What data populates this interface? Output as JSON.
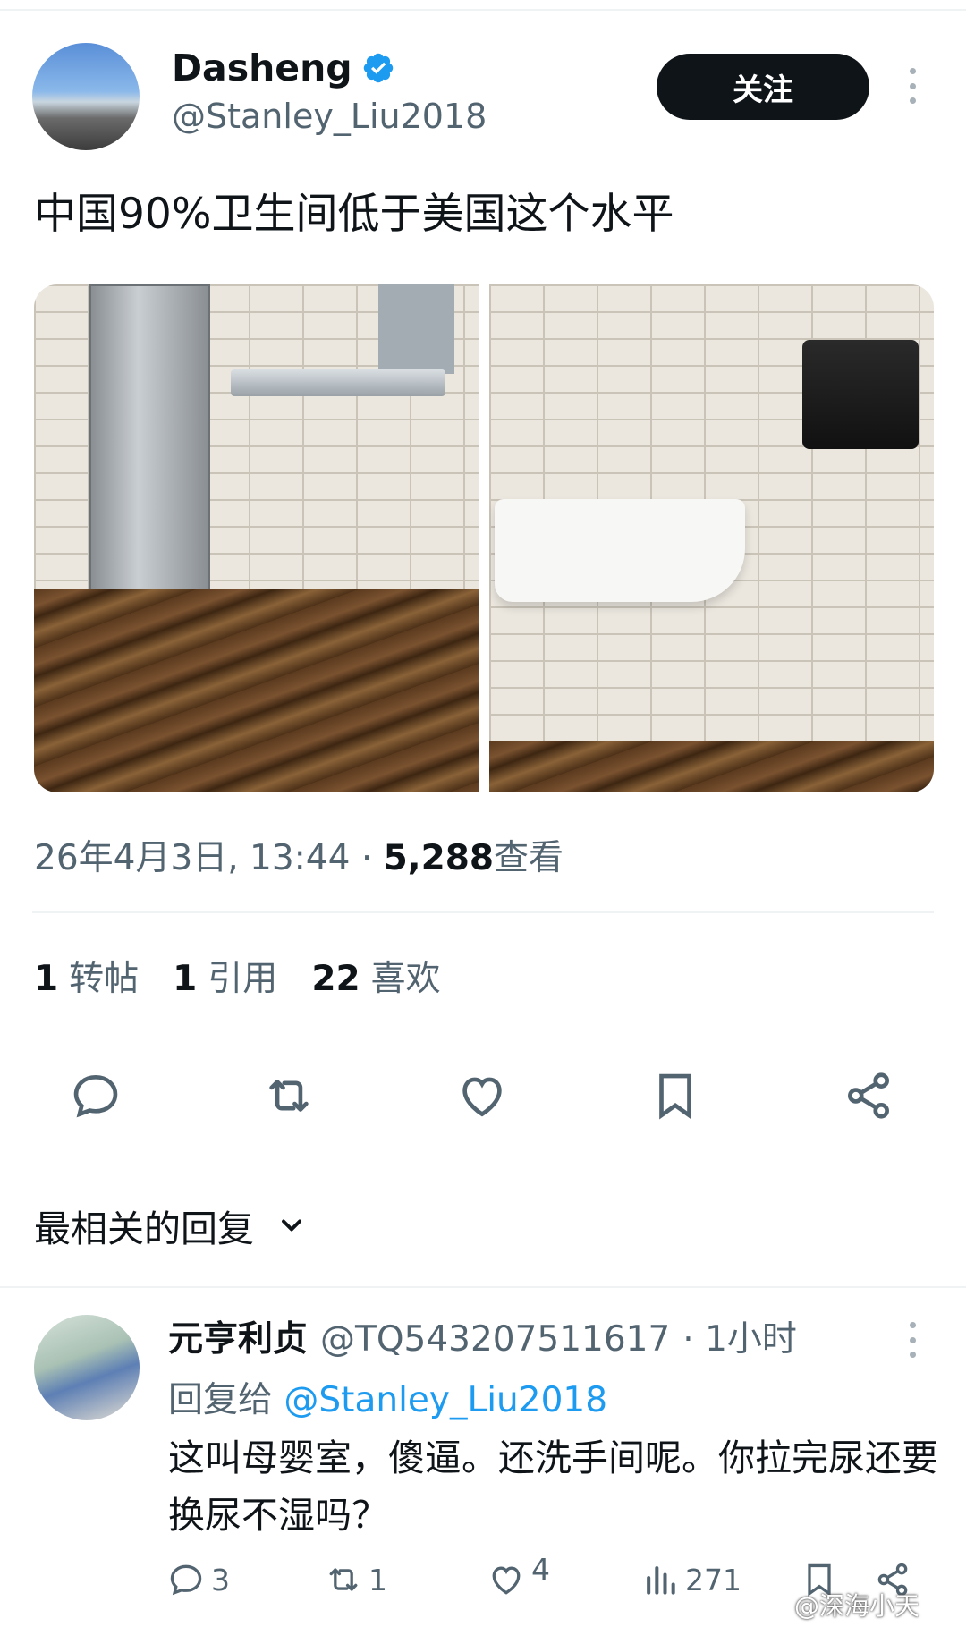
{
  "tweet": {
    "display_name": "Dasheng",
    "handle": "@Stanley_Liu2018",
    "follow_label": "关注",
    "text": "中国90%卫生间低于美国这个水平",
    "date_time": "26年4月3日, 13:44",
    "dot": "·",
    "views_count": "5,288",
    "views_label": "查看",
    "stats": {
      "reposts_count": "1",
      "reposts_label": "转帖",
      "quotes_count": "1",
      "quotes_label": "引用",
      "likes_count": "22",
      "likes_label": "喜欢"
    }
  },
  "replies_sort_label": "最相关的回复",
  "reply": {
    "display_name": "元亨利贞",
    "handle": "@TQ543207511617",
    "time": "· 1小时",
    "reply_to_prefix": "回复给",
    "reply_to_handle": "@Stanley_Liu2018",
    "text": "这叫母婴室，傻逼。还洗手间呢。你拉完尿还要换尿不湿吗？",
    "comments_count": "3",
    "reposts_count": "1",
    "likes_count": "4",
    "views_count": "271"
  },
  "watermark": "@深海小天",
  "colors": {
    "verified": "#1d9bf0",
    "link": "#1d9bf0",
    "secondary_text": "#536471",
    "primary_text": "#0f1419"
  }
}
